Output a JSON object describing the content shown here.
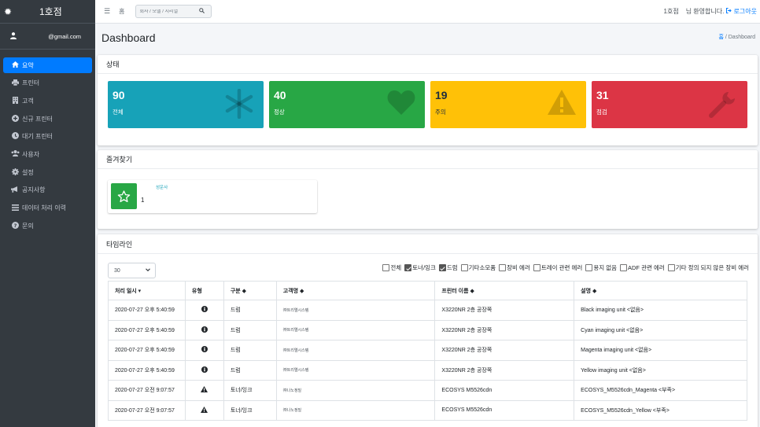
{
  "brand": {
    "name": "1호점",
    "logo_icon": "gear-icon"
  },
  "user": {
    "email": "@gmail.com",
    "icon": "user-icon"
  },
  "sidebar": {
    "items": [
      {
        "label": "요약",
        "icon": "home-icon",
        "active": true
      },
      {
        "label": "프린터",
        "icon": "printer-icon"
      },
      {
        "label": "고객",
        "icon": "building-icon"
      },
      {
        "label": "신규 프린터",
        "icon": "plus-circle-icon"
      },
      {
        "label": "대기 프린터",
        "icon": "clock-icon"
      },
      {
        "label": "사용자",
        "icon": "users-icon"
      },
      {
        "label": "설정",
        "icon": "gear-icon"
      },
      {
        "label": "공지사항",
        "icon": "megaphone-icon"
      },
      {
        "label": "데이터 처리 이력",
        "icon": "list-icon"
      },
      {
        "label": "문의",
        "icon": "question-circle-icon"
      }
    ]
  },
  "topbar": {
    "menu_glyph": "☰",
    "home_glyph": "홈",
    "search_placeholder": "회사 / 모델 / 시리얼",
    "branch": "1호점",
    "welcome": "님 환영합니다.",
    "logout": "로그아웃"
  },
  "page": {
    "title": "Dashboard",
    "breadcrumb_home": "홈",
    "breadcrumb_sep": "/",
    "breadcrumb_current": "Dashboard"
  },
  "status": {
    "header": "상태",
    "boxes": [
      {
        "value": "90",
        "label": "전체",
        "icon": "asterisk-icon",
        "color": "#17a2b8"
      },
      {
        "value": "40",
        "label": "정상",
        "icon": "heart-icon",
        "color": "#28a745"
      },
      {
        "value": "19",
        "label": "주의",
        "icon": "warning-icon",
        "color": "#ffc107"
      },
      {
        "value": "31",
        "label": "점검",
        "icon": "wrench-icon",
        "color": "#dc3545"
      }
    ]
  },
  "favorites": {
    "header": "즐겨찾기",
    "items": [
      {
        "name": "성운사",
        "count": "1",
        "icon": "star-icon"
      }
    ]
  },
  "timeline": {
    "header": "타임라인",
    "page_size": "30",
    "filters": [
      {
        "label": "전체",
        "checked": false
      },
      {
        "label": "토너/잉크",
        "checked": true
      },
      {
        "label": "드럼",
        "checked": true
      },
      {
        "label": "기타소모품",
        "checked": false
      },
      {
        "label": "장비 에러",
        "checked": false
      },
      {
        "label": "트레이 관련 에러",
        "checked": false
      },
      {
        "label": "용지 없음",
        "checked": false
      },
      {
        "label": "ADF 관련 에러",
        "checked": false
      },
      {
        "label": "기타 정의 되지 않은 장비 에러",
        "checked": false
      }
    ],
    "columns": [
      "처리 일시 ▾",
      "유형",
      "구분 ◆",
      "고객명 ◆",
      "프린터 이름 ◆",
      "설명 ◆"
    ],
    "rows": [
      {
        "time": "2020-07-27 오후 5:40:59",
        "type": "info",
        "category": "드럼",
        "customer": "㈜트리엘시스템",
        "printer": "X3220NR 2층 공장쪽",
        "desc": "Black imaging unit <없음>"
      },
      {
        "time": "2020-07-27 오후 5:40:59",
        "type": "info",
        "category": "드럼",
        "customer": "㈜트리엘시스템",
        "printer": "X3220NR 2층 공장쪽",
        "desc": "Cyan imaging unit <없음>"
      },
      {
        "time": "2020-07-27 오후 5:40:59",
        "type": "info",
        "category": "드럼",
        "customer": "㈜트리엘시스템",
        "printer": "X3220NR 2층 공장쪽",
        "desc": "Magenta imaging unit <없음>"
      },
      {
        "time": "2020-07-27 오후 5:40:59",
        "type": "info",
        "category": "드럼",
        "customer": "㈜트리엘시스템",
        "printer": "X3220NR 2층 공장쪽",
        "desc": "Yellow imaging unit <없음>"
      },
      {
        "time": "2020-07-27 오전 9:07:57",
        "type": "warning",
        "category": "토너/잉크",
        "customer": "㈜나노정밀",
        "printer": "ECOSYS M5526cdn",
        "desc": "ECOSYS_M5526cdn_Magenta <부족>"
      },
      {
        "time": "2020-07-27 오전 9:07:57",
        "type": "warning",
        "category": "토너/잉크",
        "customer": "㈜나노정밀",
        "printer": "ECOSYS M5526cdn",
        "desc": "ECOSYS_M5526cdn_Yellow <부족>"
      }
    ]
  }
}
